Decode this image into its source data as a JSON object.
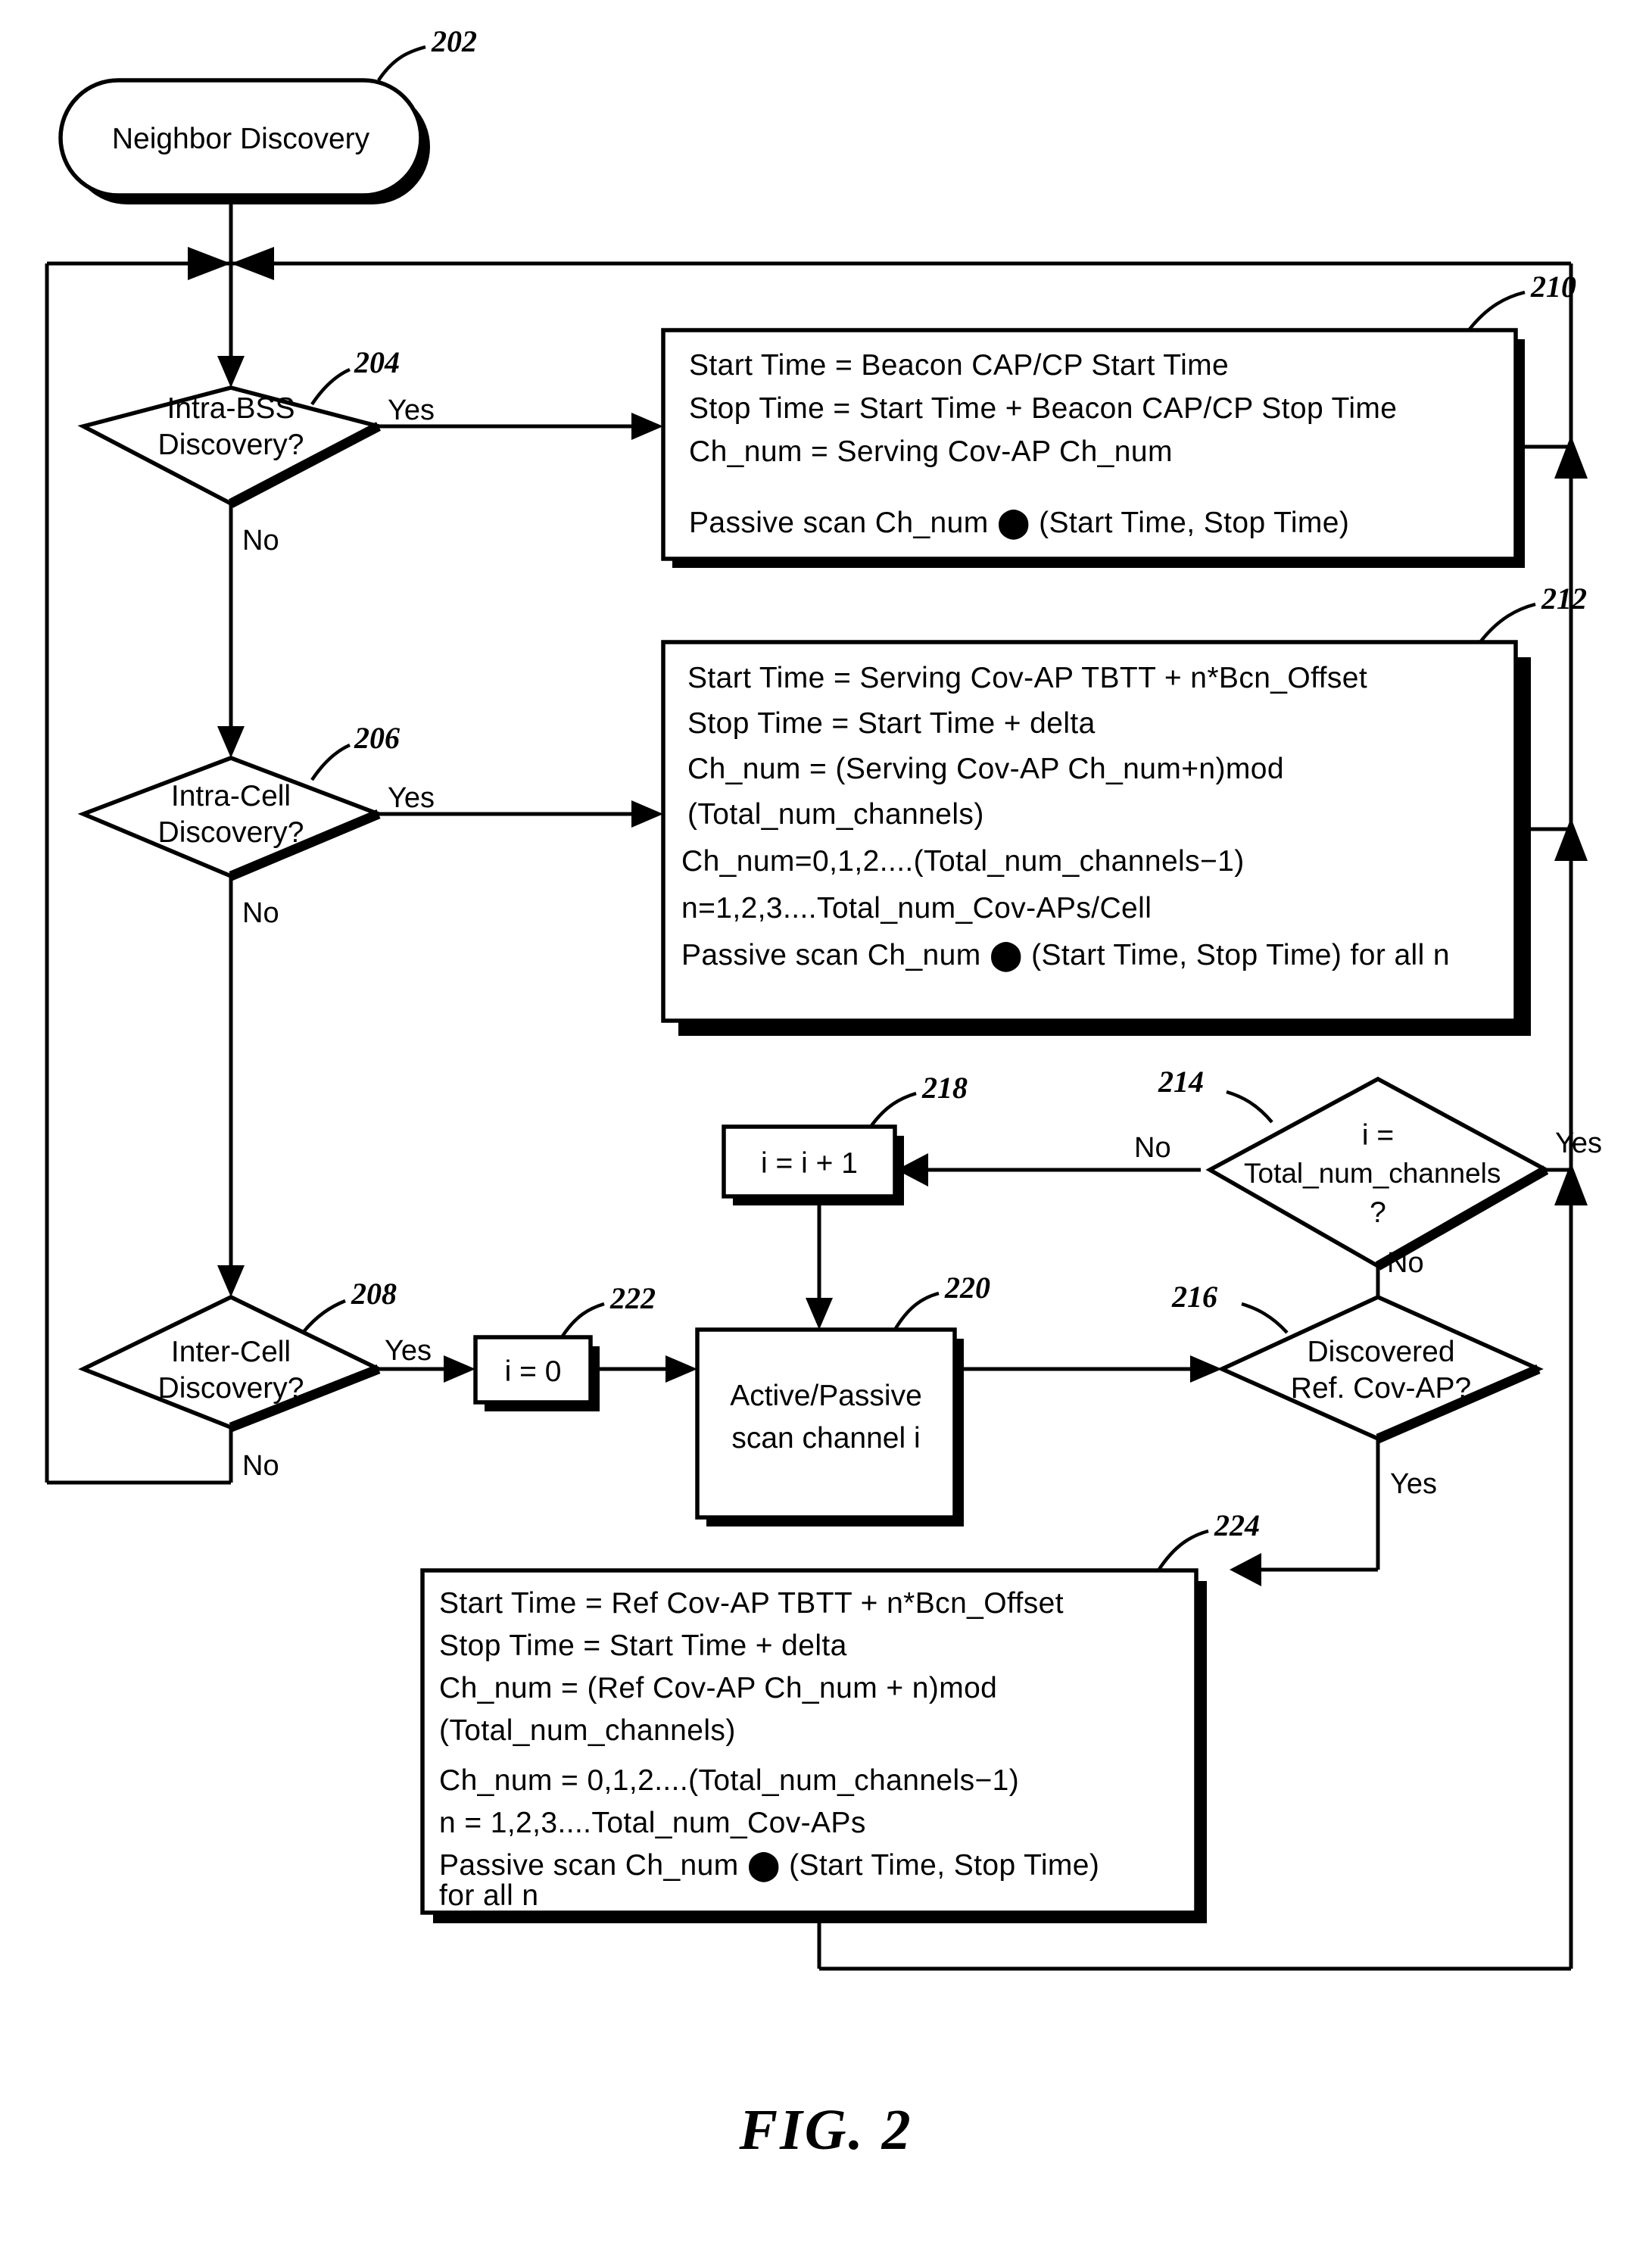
{
  "figure": {
    "caption": "FIG. 2",
    "start_node": {
      "ref": "202",
      "label": "Neighbor Discovery"
    },
    "decisions": [
      {
        "ref": "204",
        "line1": "Intra-BSS",
        "line2": "Discovery?",
        "yes_label": "Yes",
        "no_label": "No"
      },
      {
        "ref": "206",
        "line1": "Intra-Cell",
        "line2": "Discovery?",
        "yes_label": "Yes",
        "no_label": "No"
      },
      {
        "ref": "208",
        "line1": "Inter-Cell",
        "line2": "Discovery?",
        "yes_label": "Yes",
        "no_label": "No"
      },
      {
        "ref": "214",
        "line1": "i =",
        "line2": "Total_num_channels",
        "line3": "?",
        "yes_label": "Yes",
        "no_label": "No"
      },
      {
        "ref": "216",
        "line1": "Discovered",
        "line2": "Ref. Cov-AP?",
        "yes_label": "Yes",
        "no_label": "No"
      }
    ],
    "process_210": {
      "ref": "210",
      "lines": [
        "Start Time = Beacon CAP/CP Start Time",
        "Stop Time = Start Time + Beacon CAP/CP Stop Time",
        "Ch_num = Serving Cov-AP Ch_num",
        "",
        "Passive scan Ch_num ⬤ (Start Time, Stop Time)"
      ]
    },
    "process_212": {
      "ref": "212",
      "lines": [
        "Start Time = Serving Cov-AP TBTT + n*Bcn_Offset",
        "Stop Time =  Start Time + delta",
        "Ch_num = (Serving Cov-AP Ch_num+n)mod",
        "            (Total_num_channels)",
        "Ch_num=0,1,2....(Total_num_channels−1)",
        "n=1,2,3....Total_num_Cov-APs/Cell",
        "Passive scan Ch_num ⬤ (Start Time, Stop Time) for all n"
      ]
    },
    "process_218": {
      "ref": "218",
      "label": "i = i + 1"
    },
    "process_220": {
      "ref": "220",
      "line1": "Active/Passive",
      "line2": "scan channel i"
    },
    "process_222": {
      "ref": "222",
      "label": "i = 0"
    },
    "process_224": {
      "ref": "224",
      "lines": [
        "Start Time = Ref Cov-AP TBTT + n*Bcn_Offset",
        "Stop Time = Start Time + delta",
        "Ch_num = (Ref Cov-AP Ch_num + n)mod",
        "            (Total_num_channels)",
        "Ch_num = 0,1,2....(Total_num_channels−1)",
        "n = 1,2,3....Total_num_Cov-APs",
        "Passive scan Ch_num ⬤ (Start Time, Stop Time)",
        "for all n"
      ]
    }
  },
  "colors": {
    "ink": "#000000",
    "paper": "#ffffff"
  }
}
